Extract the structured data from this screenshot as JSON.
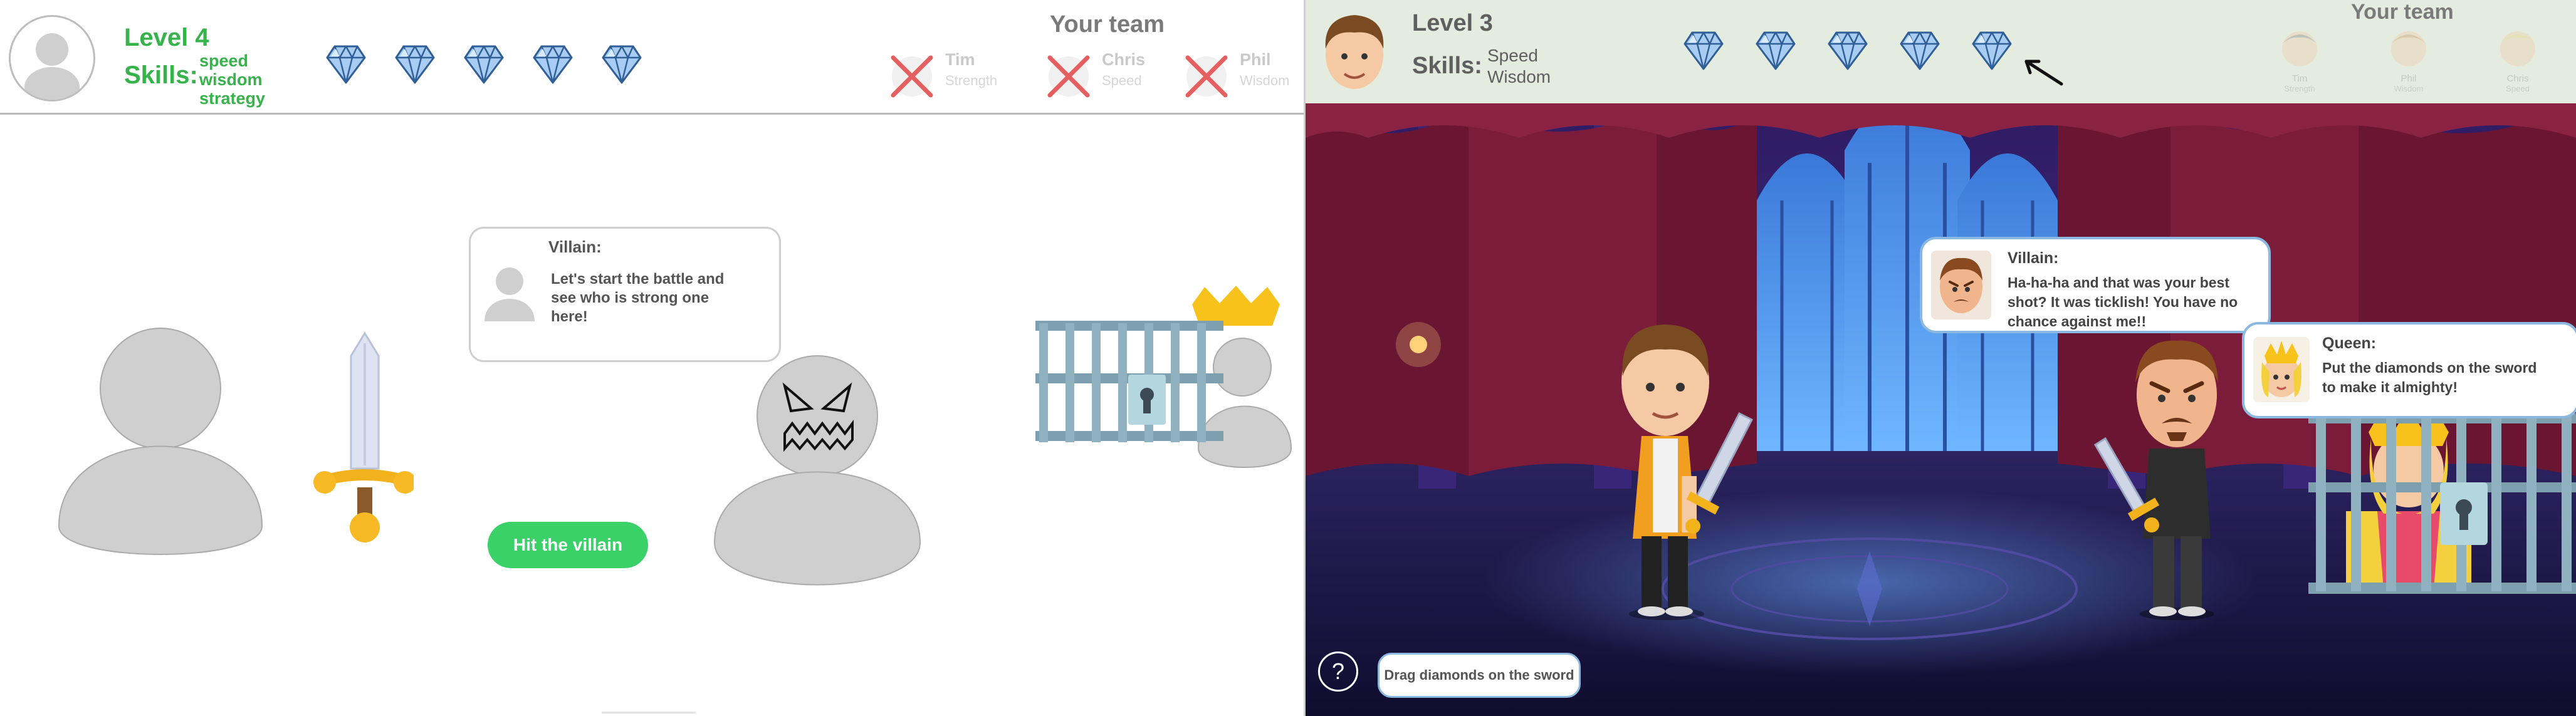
{
  "left": {
    "header": {
      "level": "Level 4",
      "skills_label": "Skills:",
      "skills": [
        "speed",
        "wisdom",
        "strategy"
      ],
      "diamond_count": 5
    },
    "team": {
      "title": "Your team",
      "members": [
        {
          "name": "Tim",
          "skill": "Strength"
        },
        {
          "name": "Chris",
          "skill": "Speed"
        },
        {
          "name": "Phil",
          "skill": "Wisdom"
        }
      ]
    },
    "dialog": {
      "speaker": "Villain:",
      "text_lines": [
        "Let's start the battle and",
        "see who is strong one",
        "here!"
      ]
    },
    "action_button": "Hit the villain"
  },
  "right": {
    "header": {
      "level": "Level 3",
      "skills_label": "Skills:",
      "skills": [
        "Speed",
        "Wisdom"
      ],
      "diamond_count": 5
    },
    "team": {
      "title": "Your team",
      "members": [
        {
          "name": "Tim",
          "skill": "Strength"
        },
        {
          "name": "Phil",
          "skill": "Wisdom"
        },
        {
          "name": "Chris",
          "skill": "Speed"
        }
      ]
    },
    "villain_dialog": {
      "speaker": "Villain:",
      "text_lines": [
        "Ha-ha-ha and that was your best",
        "shot? It was ticklish! You have no",
        "chance against me!!"
      ]
    },
    "queen_dialog": {
      "speaker": "Queen:",
      "text_lines": [
        "Put the diamonds on the sword",
        "to make it almighty!"
      ]
    },
    "help_glyph": "?",
    "hint": "Drag diamonds on the sword"
  },
  "colors": {
    "accent_green": "#36b34a",
    "button_green": "#3ad169",
    "diamond_blue": "#7fb2e8",
    "bubble_border_blue": "#8ab8e0",
    "cross_red": "#e46060",
    "castle_purple": "#2a1d63"
  },
  "icons": [
    "avatar-icon",
    "diamond-icon",
    "cross-icon",
    "sword-icon",
    "crown-icon",
    "cage-icon",
    "lock-icon",
    "arrow-icon",
    "help-icon"
  ]
}
